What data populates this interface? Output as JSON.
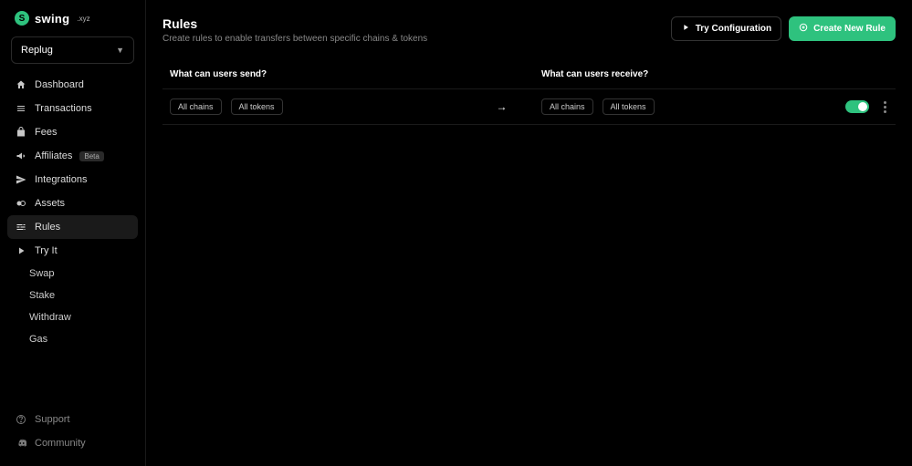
{
  "brand": {
    "name": "swing",
    "suffix": ".xyz"
  },
  "workspace": {
    "selected": "Replug"
  },
  "nav": {
    "items": [
      {
        "label": "Dashboard"
      },
      {
        "label": "Transactions"
      },
      {
        "label": "Fees"
      },
      {
        "label": "Affiliates",
        "badge": "Beta"
      },
      {
        "label": "Integrations"
      },
      {
        "label": "Assets"
      },
      {
        "label": "Rules",
        "active": true
      },
      {
        "label": "Try It"
      }
    ],
    "sub": [
      {
        "label": "Swap"
      },
      {
        "label": "Stake"
      },
      {
        "label": "Withdraw"
      },
      {
        "label": "Gas"
      }
    ],
    "bottom": [
      {
        "label": "Support"
      },
      {
        "label": "Community"
      }
    ]
  },
  "page": {
    "title": "Rules",
    "subtitle": "Create rules to enable transfers between specific chains & tokens"
  },
  "actions": {
    "try": "Try Configuration",
    "create": "Create New Rule"
  },
  "table": {
    "send_header": "What can users send?",
    "receive_header": "What can users receive?",
    "row": {
      "send_chain": "All chains",
      "send_token": "All tokens",
      "receive_chain": "All chains",
      "receive_token": "All tokens",
      "enabled": true
    }
  },
  "colors": {
    "accent": "#2ec27e"
  }
}
